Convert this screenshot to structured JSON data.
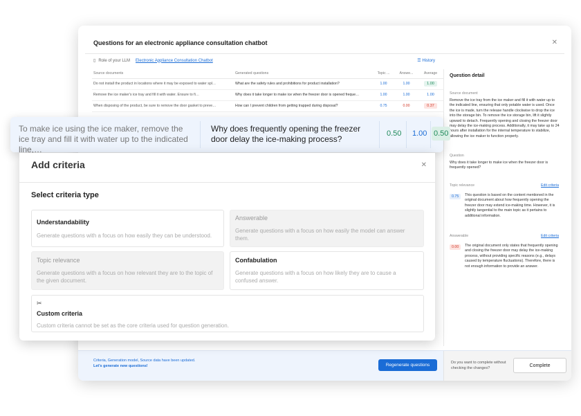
{
  "window": {
    "title": "Questions for an electronic appliance consultation chatbot",
    "role_label": "Role of your LLM",
    "role_link": "Electronic Appliance Consultation Chatbot",
    "history": "History"
  },
  "table": {
    "headers": [
      "Source documents",
      "Generated questions",
      "Topic ...",
      "Answe...",
      "Average"
    ],
    "rows": [
      {
        "src": "Do not install the product in locations where it may be exposed to water spl…",
        "q": "What are the safety rules and prohibitions for product installation?",
        "topic": "1.00",
        "answer": "1.00",
        "avg": "1.00",
        "avg_style": "green"
      },
      {
        "src": "Remove the ice maker's ice tray and fill it with water. Ensure to fi…",
        "q": "Why does it take longer to make ice when the freezer door is opened freque…",
        "topic": "1.00",
        "answer": "1.00",
        "avg": "1.00",
        "avg_style": "blue"
      },
      {
        "src": "When disposing of the product, be sure to remove the door gasket to preve…",
        "q": "How can I prevent children from getting trapped during disposal?",
        "topic": "0.75",
        "answer": "0.00",
        "avg": "0.37",
        "avg_style": "red"
      }
    ]
  },
  "detail": {
    "title": "Question detail",
    "source_label": "Source document",
    "source_text": "Remove the ice tray from the ice maker and fill it with water up to the indicated line, ensuring that only potable water is used. Once the ice is made, turn the release handle clockwise to drop the ice into the storage bin. To remove the ice storage bin, lift it slightly upward to detach. Frequently opening and closing the freezer door may delay the ice-making process. Additionally, it may take up to 24 hours after installation for the internal temperature to stabilize, allowing the ice maker to function properly.",
    "question_label": "Question",
    "question_text": "Why does it take longer to make ice when the freezer door is frequently opened?",
    "topic_label": "Topic relevance",
    "topic_edit": "Edit criteria",
    "topic_score": "0.75",
    "topic_text": "This question is based on the content mentioned in the original document about how frequently opening the freezer door may extend ice-making time. However, it is slightly tangential to the main topic as it pertains to additional information.",
    "answer_label": "Answerable",
    "answer_edit": "Edit criteria",
    "answer_score": "0.00",
    "answer_text": "The original document only states that frequently opening and closing the freezer door may delay the ice-making process, without providing specific reasons (e.g., delays caused by temperature fluctuations). Therefore, there is not enough information to provide an answer."
  },
  "footer": {
    "msg1": "Criteria, Generation model, Source data have been updated.",
    "msg2": "Let's generate new questions!",
    "regenerate": "Regenerate questions",
    "complete_q": "Do you want to complete without checking the changes?",
    "complete": "Complete"
  },
  "highlight": {
    "source": "To make ice using the ice maker, remove the ice tray and fill it with water up to the indicated line,…",
    "question": "Why does frequently opening the freezer door delay the ice-making process?",
    "s1": "0.50",
    "s2": "1.00",
    "s3": "0.50"
  },
  "modal": {
    "title": "Add criteria",
    "subtitle": "Select criteria type",
    "cards": [
      {
        "title": "Understandability",
        "desc": "Generate questions with a focus on how easily they can be understood."
      },
      {
        "title": "Answerable",
        "desc": "Generate questions with a focus on how easily the model can answer them."
      },
      {
        "title": "Topic relevance",
        "desc": "Generate questions with a focus on how relevant they are to the topic of the given document."
      },
      {
        "title": "Confabulation",
        "desc": "Generate questions with a focus on how likely they are to cause a confused answer."
      },
      {
        "title": "Custom criteria",
        "desc": "Custom criteria cannot be set as the core criteria used for question generation."
      }
    ]
  },
  "colors": {
    "accent": "#1a6cd6",
    "green": "#1f8a5a",
    "red": "#d23b2b"
  }
}
